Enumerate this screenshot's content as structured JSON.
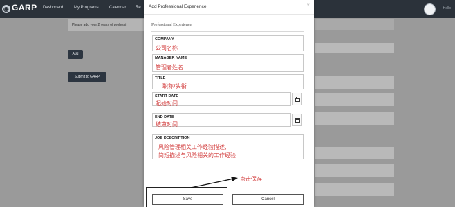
{
  "nav": {
    "logo": "GARP",
    "items": [
      "Dashboard",
      "My Programs",
      "Calendar",
      "Re"
    ],
    "user_label": "Hello"
  },
  "background": {
    "notice": "Please add your 2 years of professi",
    "add_button": "Add",
    "submit_button": "Submit to GARP"
  },
  "modal": {
    "title": "Add Professional Experience",
    "close": "×",
    "section": "Professional Experience",
    "fields": {
      "company": {
        "label": "COMPANY",
        "value": "公司名称"
      },
      "manager": {
        "label": "MANAGER NAME",
        "value": "管理者姓名"
      },
      "title": {
        "label": "TITLE",
        "value": "职称/头衔"
      },
      "start": {
        "label": "START DATE",
        "value": "起始时间"
      },
      "end": {
        "label": "END DATE",
        "value": "结束时间"
      },
      "description": {
        "label": "JOB DESCRIPTION",
        "line1": "风险管理相关工作经验描述,",
        "line2": "简短描述与风险相关的工作经验"
      }
    },
    "save": "Save",
    "cancel": "Cancel"
  },
  "annotation": {
    "text": "点击保存",
    "color": "#d23a3a"
  }
}
